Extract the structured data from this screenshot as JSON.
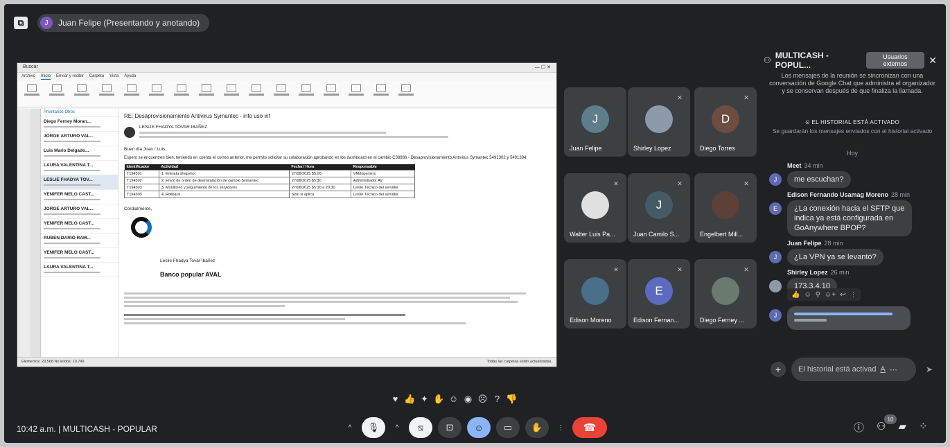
{
  "topbar": {
    "presenter_initial": "J",
    "presenter_label": "Juan Felipe (Presentando y anotando)"
  },
  "shared_screen": {
    "window_title": "Buscar",
    "menu": [
      "Archivo",
      "Inicio",
      "Enviar y recibir",
      "Carpeta",
      "Vista",
      "Ayuda"
    ],
    "list_tabs": "Prioritarios   Otros",
    "list_items": [
      "Diego Ferney Moran...",
      "JORGE ARTURO VAL...",
      "Luis Mario Delgado...",
      "LAURA VALENTINA T...",
      "LESLIE FHADYA TOV...",
      "YENIFER MELO CAST...",
      "JORGE ARTURO VAL...",
      "YENIFER MELO CAST...",
      "RUBEN DARIO RAM...",
      "YENIFER MELO CAST...",
      "LAURA VALENTINA T..."
    ],
    "subject": "RE: Desaprovisionamiento Antivirus Symantec - info uso inf",
    "sender": "LESLIE FHADYA TOVAR IBAÑEZ",
    "greeting": "Buen día Juan / Luis,",
    "intro": "Espero se encuentren bien, teniendo en cuenta el correo anterior, me permito solicitar su colaboración aprobando en los dashboard en el cambio C38986 - Desaprovisionamiento Antivirus Symantec 5491302 y 5491394:",
    "table_headers": [
      "Identificador",
      "Actividad",
      "Fecha / Hora",
      "Responsable"
    ],
    "table_rows": [
      [
        "T194501",
        "1. Entrada shapshot",
        "27/08/2025 $5:00",
        "VM/Ingeniero"
      ],
      [
        "T194502",
        "2. Envió de orden de desinstalación de cambio Symantec",
        "27/08/2025 $5:30",
        "Administrador AV"
      ],
      [
        "T194503",
        "3. Monitoreo y seguimiento de los servidores",
        "27/08/2025 $5:30 a 20:30",
        "Leslie Técnico del servidor"
      ],
      [
        "T194500",
        "4. Rollback",
        "Sólo si aplica",
        "Leslie Técnico del servidor"
      ]
    ],
    "closing": "Cordialmente,",
    "signature_name": "Leslie Fhadya Tovar Ibáñez",
    "signature_company": "Banco popular AVAL",
    "status_left": "Elementos: 29.568   No leídos: 10.749",
    "status_right": "Todas las carpetas están actualizadas."
  },
  "participants": [
    {
      "name": "Juan Felipe",
      "initial": "J",
      "color": "#607d8b"
    },
    {
      "name": "Shirley Lopez",
      "initial": "",
      "color": "#8d9aa8"
    },
    {
      "name": "Diego Torres",
      "initial": "D",
      "color": "#6d4c41"
    },
    {
      "name": "Walter Luis Pa...",
      "initial": "",
      "color": "#e0e0e0"
    },
    {
      "name": "Juan Camilo S...",
      "initial": "J",
      "color": "#455a64"
    },
    {
      "name": "Engelbert Mill...",
      "initial": "",
      "color": "#5d4037"
    },
    {
      "name": "Edison Moreno",
      "initial": "",
      "color": "#4a6f8a"
    },
    {
      "name": "Edison Fernan...",
      "initial": "E",
      "color": "#5c6bc0"
    },
    {
      "name": "Diego Ferney ...",
      "initial": "",
      "color": "#6a7a6e"
    }
  ],
  "chat": {
    "title": "MULTICASH - POPUL...",
    "external_badge": "Usuarios externos",
    "info": "Los mensajes de la reunión se sincronizan con una conversación de Google Chat que administra el organizador y se conservan después de que finaliza la llamada.",
    "history_on": "EL HISTORIAL ESTÁ ACTIVADO",
    "history_sub": "Se guardarán los mensajes enviados con el historial activado",
    "day": "Hoy",
    "messages": [
      {
        "author": "Meet",
        "time": "34 min",
        "text": "me escuchan?",
        "initial": "J"
      },
      {
        "author": "Edison Fernando Usamag Moreno",
        "time": "28 min",
        "text": "¿La conexión hacia el SFTP que indica ya está configurada en GoAnywhere BPOP?",
        "initial": "E"
      },
      {
        "author": "Juan Felipe",
        "time": "28 min",
        "text": "¿La VPN ya se levantó?",
        "initial": "J"
      },
      {
        "author": "Shirley Lopez",
        "time": "26 min",
        "text": "173.3.4.10",
        "initial": ""
      }
    ],
    "input_placeholder": "El historial está activad"
  },
  "bottom": {
    "time": "10:42 a.m.",
    "meeting": "MULTICASH - POPULAR",
    "participant_count": "10"
  }
}
